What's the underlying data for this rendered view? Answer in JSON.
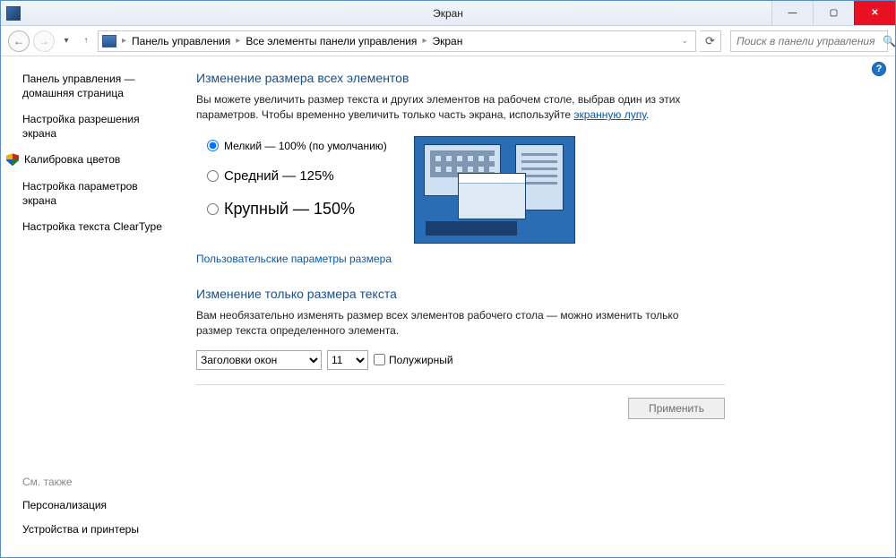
{
  "title": "Экран",
  "toolbar": {
    "breadcrumbs": [
      "Панель управления",
      "Все элементы панели управления",
      "Экран"
    ],
    "search_placeholder": "Поиск в панели управления"
  },
  "sidebar": {
    "links": [
      "Панель управления — домашняя страница",
      "Настройка разрешения экрана",
      "Калибровка цветов",
      "Настройка параметров экрана",
      "Настройка текста ClearType"
    ],
    "shield_index": 2,
    "see_also_header": "См. также",
    "see_also": [
      "Персонализация",
      "Устройства и принтеры"
    ]
  },
  "main": {
    "section1_title": "Изменение размера всех элементов",
    "section1_text": "Вы можете увеличить размер текста и других элементов на рабочем столе, выбрав один из этих параметров. Чтобы временно увеличить только часть экрана, используйте ",
    "section1_link": "экранную лупу",
    "radios": [
      "Мелкий — 100% (по умолчанию)",
      "Средний — 125%",
      "Крупный — 150%"
    ],
    "radio_selected": 0,
    "custom_link": "Пользовательские параметры размера",
    "section2_title": "Изменение только размера текста",
    "section2_text": "Вам необязательно изменять размер всех элементов рабочего стола — можно изменить только размер текста определенного элемента.",
    "element_select": "Заголовки окон",
    "size_select": "11",
    "bold_label": "Полужирный",
    "apply_label": "Применить"
  }
}
